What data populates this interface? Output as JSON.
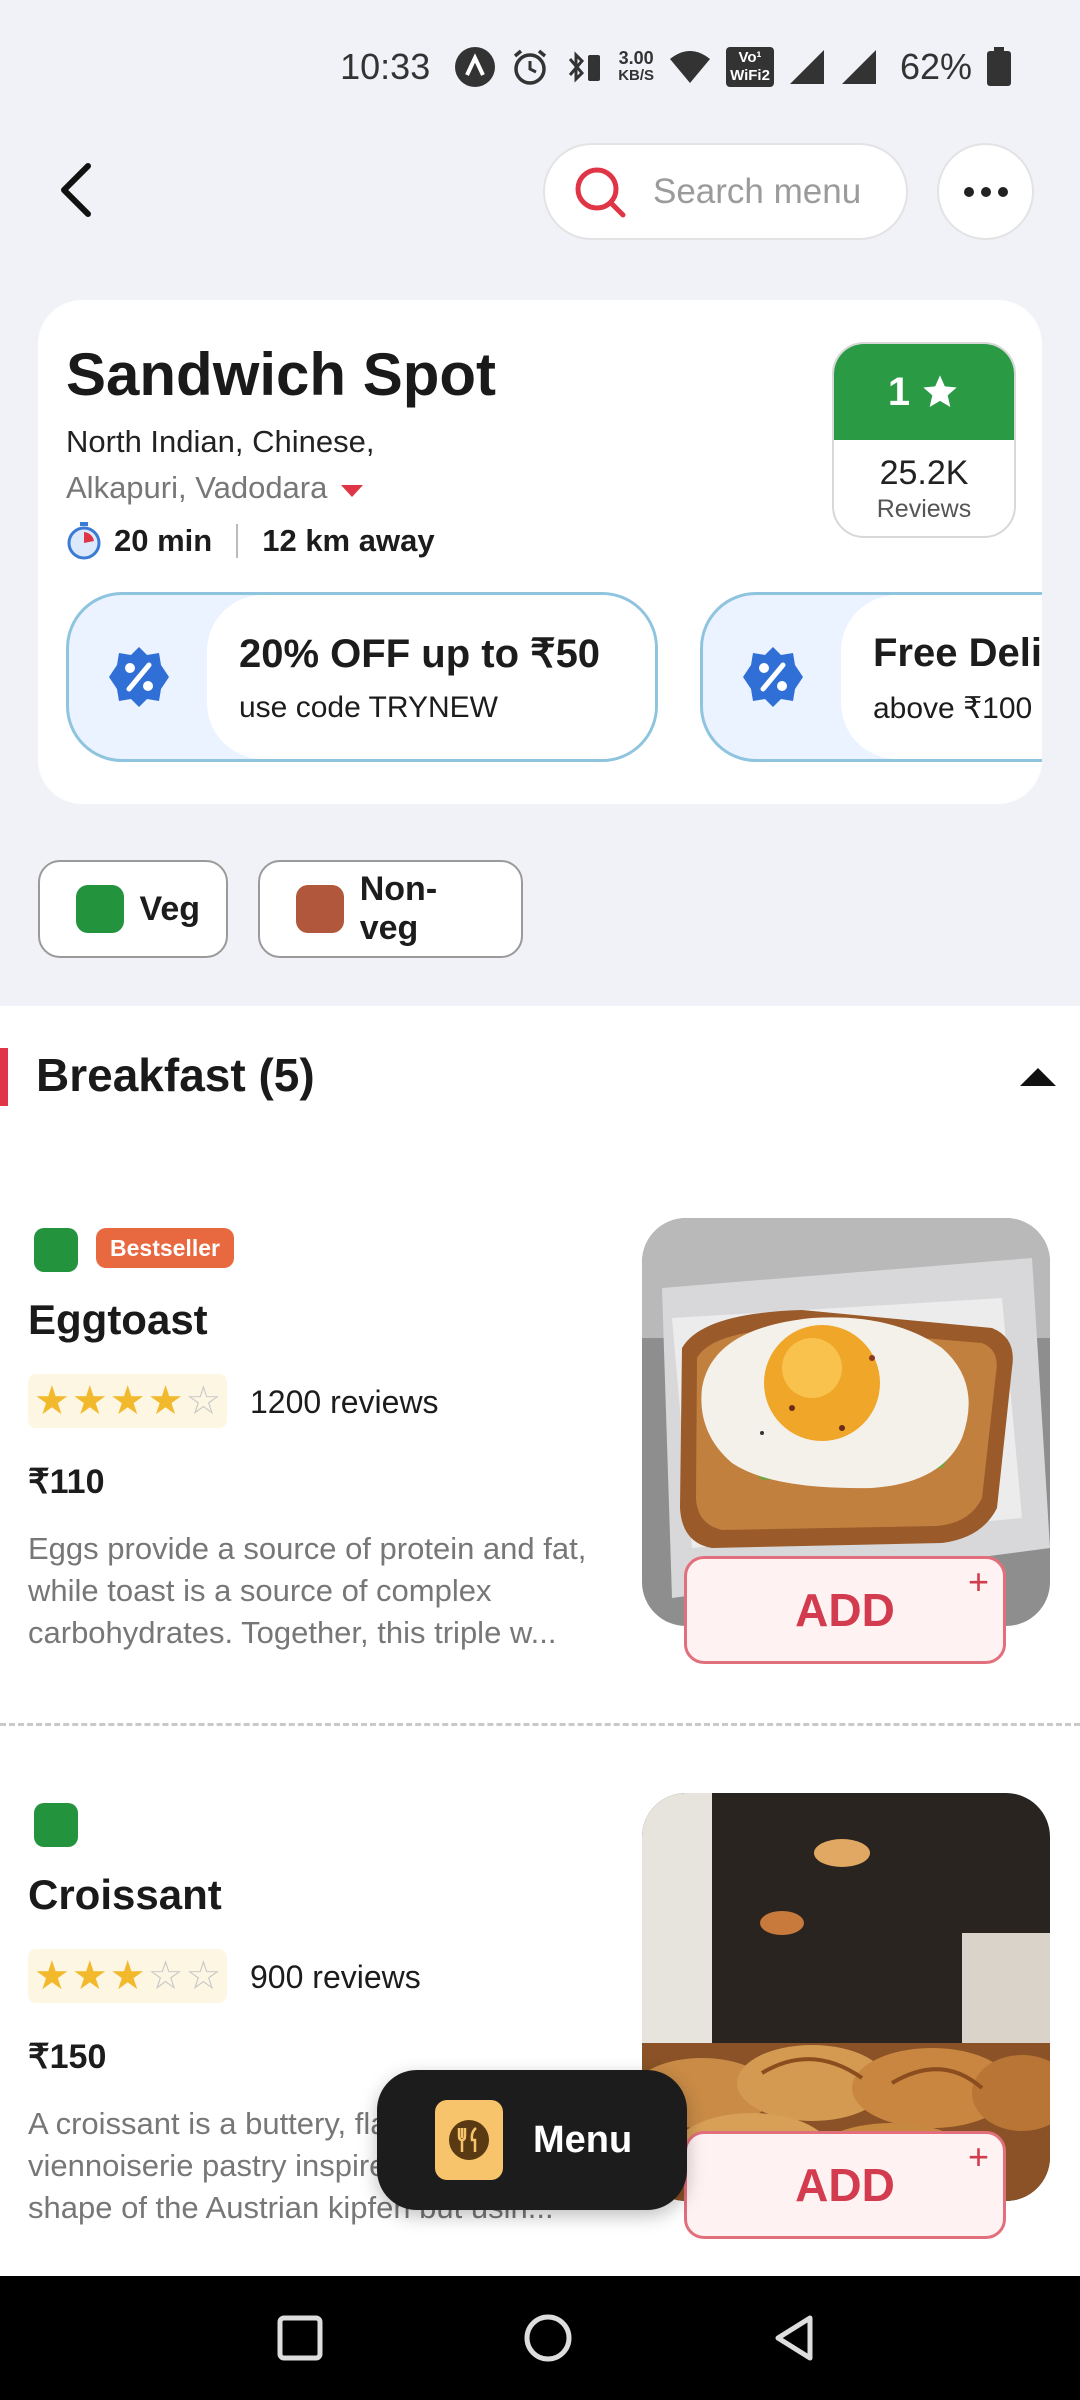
{
  "status_bar": {
    "time": "10:33",
    "speed": [
      "3.00",
      "KB/S"
    ],
    "volte": [
      "Vo¹",
      "WiFi2"
    ],
    "battery": "62%"
  },
  "top_bar": {
    "search_placeholder": "Search menu"
  },
  "restaurant": {
    "name": "Sandwich Spot",
    "cuisine": "North Indian, Chinese,",
    "location": "Alkapuri, Vadodara",
    "delivery_time": "20 min",
    "distance": "12 km away",
    "rating": "1",
    "reviews_count": "25.2K",
    "reviews_label": "Reviews"
  },
  "offers": [
    {
      "title": "20% OFF up to ₹50",
      "subtitle": "use code TRYNEW"
    },
    {
      "title": "Free Delivery",
      "subtitle": "above ₹100"
    }
  ],
  "filters": [
    {
      "label": "Veg",
      "color": "#23933d"
    },
    {
      "label": "Non-veg",
      "color": "#b0573c"
    }
  ],
  "category": {
    "title": "Breakfast (5)"
  },
  "items": [
    {
      "name": "Eggtoast",
      "badge": "Bestseller",
      "stars": 4,
      "reviews": "1200 reviews",
      "price": "₹110",
      "description": "Eggs provide a source of protein and fat, while toast is a source of complex carbohydrates. Together, this triple w...",
      "add_label": "ADD"
    },
    {
      "name": "Croissant",
      "badge": "",
      "stars": 3,
      "reviews": "900 reviews",
      "price": "₹150",
      "description": "A croissant is a buttery, flaky viennoiserie pastry inspired by the shape of the Austrian kipferl but usin...",
      "add_label": "ADD"
    }
  ],
  "floating_menu": {
    "label": "Menu"
  },
  "colors": {
    "rating_green": "#2a9a45",
    "accent_red": "#e03546",
    "veg_green": "#23933d",
    "bestseller_orange": "#e8683f"
  }
}
